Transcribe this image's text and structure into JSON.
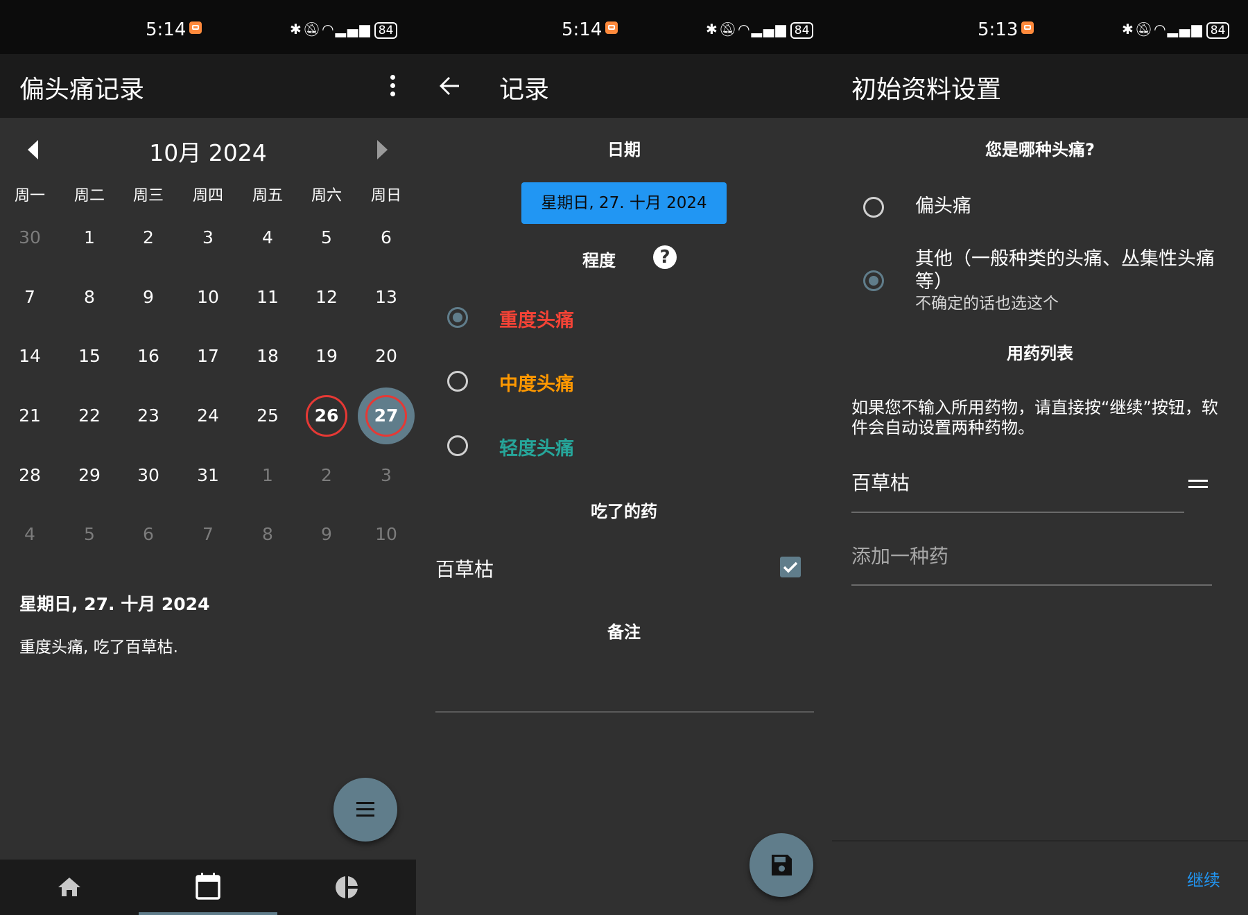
{
  "status_bars": [
    {
      "time": "5:14",
      "battery": "84"
    },
    {
      "time": "5:14",
      "battery": "84"
    },
    {
      "time": "5:13",
      "battery": "84"
    }
  ],
  "screen1": {
    "title": "偏头痛记录",
    "month_label": "10月 2024",
    "weekdays": [
      "周一",
      "周二",
      "周三",
      "周四",
      "周五",
      "周六",
      "周日"
    ],
    "weeks": [
      [
        "30",
        "1",
        "2",
        "3",
        "4",
        "5",
        "6"
      ],
      [
        "7",
        "8",
        "9",
        "10",
        "11",
        "12",
        "13"
      ],
      [
        "14",
        "15",
        "16",
        "17",
        "18",
        "19",
        "20"
      ],
      [
        "21",
        "22",
        "23",
        "24",
        "25",
        "26",
        "27"
      ],
      [
        "28",
        "29",
        "30",
        "31",
        "1",
        "2",
        "3"
      ],
      [
        "4",
        "5",
        "6",
        "7",
        "8",
        "9",
        "10"
      ]
    ],
    "selected_date": "星期日, 27. 十月 2024",
    "selected_note": "重度头痛, 吃了百草枯."
  },
  "screen2": {
    "title": "记录",
    "date_section": "日期",
    "date_value": "星期日, 27. 十月 2024",
    "severity_section": "程度",
    "help_glyph": "?",
    "severity_options": [
      {
        "label": "重度头痛",
        "color": "#f44336",
        "selected": true
      },
      {
        "label": "中度头痛",
        "color": "#ff9800",
        "selected": false
      },
      {
        "label": "轻度头痛",
        "color": "#26a69a",
        "selected": false
      }
    ],
    "meds_section": "吃了的药",
    "medication": "百草枯",
    "medication_checked": true,
    "notes_section": "备注"
  },
  "screen3": {
    "title": "初始资料设置",
    "question": "您是哪种头痛?",
    "option_migraine": "偏头痛",
    "option_other_line1": "其他（一般种类的头痛、丛集性头痛",
    "option_other_line2": "等）",
    "option_other_hint": "不确定的话也选这个",
    "option_selected": "other",
    "med_list_title": "用药列表",
    "med_hint_line1": "如果您不输入所用药物，请直接按“继续”按钮，软",
    "med_hint_line2": "件会自动设置两种药物。",
    "med_item": "百草枯",
    "add_med_placeholder": "添加一种药",
    "continue_label": "继续"
  },
  "colors": {
    "primary": "#607d8b",
    "accent_blue": "#2196f3",
    "today_ring": "#e53935",
    "background": "#303030",
    "appbar": "#1b1b1b"
  },
  "icons": [
    "bluetooth-icon",
    "mute-icon",
    "wifi-icon",
    "signal-icon",
    "battery-icon",
    "more-vert-icon",
    "back-arrow-icon",
    "prev-month-icon",
    "next-month-icon",
    "list-icon",
    "home-icon",
    "calendar-icon",
    "pie-chart-icon",
    "save-icon",
    "help-icon",
    "drag-handle-icon",
    "check-icon"
  ]
}
